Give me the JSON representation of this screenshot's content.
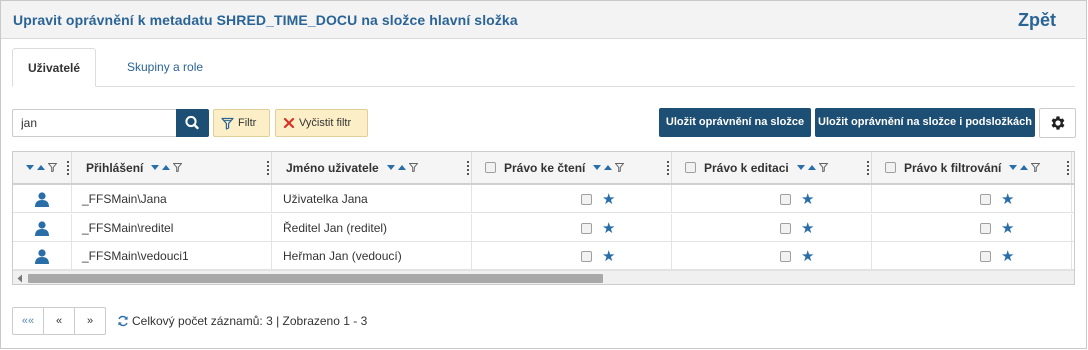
{
  "header": {
    "title": "Upravit oprávnění k metadatu SHRED_TIME_DOCU na složce hlavní složka",
    "back_label": "Zpět"
  },
  "tabs": [
    {
      "label": "Uživatelé",
      "active": true
    },
    {
      "label": "Skupiny a role",
      "active": false
    }
  ],
  "toolbar": {
    "search_value": "jan",
    "search_icon": "search-icon",
    "filter_label": "Filtr",
    "clear_filter_label": "Vyčistit filtr",
    "save_folder_label": "Uložit oprávnění na složce",
    "save_subfolders_label": "Uložit oprávnění na složce i podsložkách",
    "settings_icon": "gear-icon"
  },
  "grid": {
    "columns": [
      {
        "key": "icon",
        "label": ""
      },
      {
        "key": "login",
        "label": "Přihlášení"
      },
      {
        "key": "name",
        "label": "Jméno uživatele"
      },
      {
        "key": "read",
        "label": "Právo ke čtení"
      },
      {
        "key": "edit",
        "label": "Právo k editaci"
      },
      {
        "key": "filter",
        "label": "Právo k filtrování"
      }
    ],
    "rows": [
      {
        "login": "_FFSMain\\Jana",
        "name": "Uživatelka Jana"
      },
      {
        "login": "_FFSMain\\reditel",
        "name": "Ředitel Jan (reditel)"
      },
      {
        "login": "_FFSMain\\vedouci1",
        "name": "Heřman Jan (vedoucí)"
      }
    ]
  },
  "pager": {
    "first_label": "«« ",
    "prev_label": "«",
    "next_label": "»",
    "info": "Celkový počet záznamů: 3 | Zobrazeno 1 - 3"
  },
  "colors": {
    "accent": "#2a6496",
    "dark_button": "#1d4e73",
    "filter_button": "#fcefc7",
    "user_icon": "#2a6ea8",
    "star": "#2a6ea8",
    "clear_x": "#d9342b"
  }
}
